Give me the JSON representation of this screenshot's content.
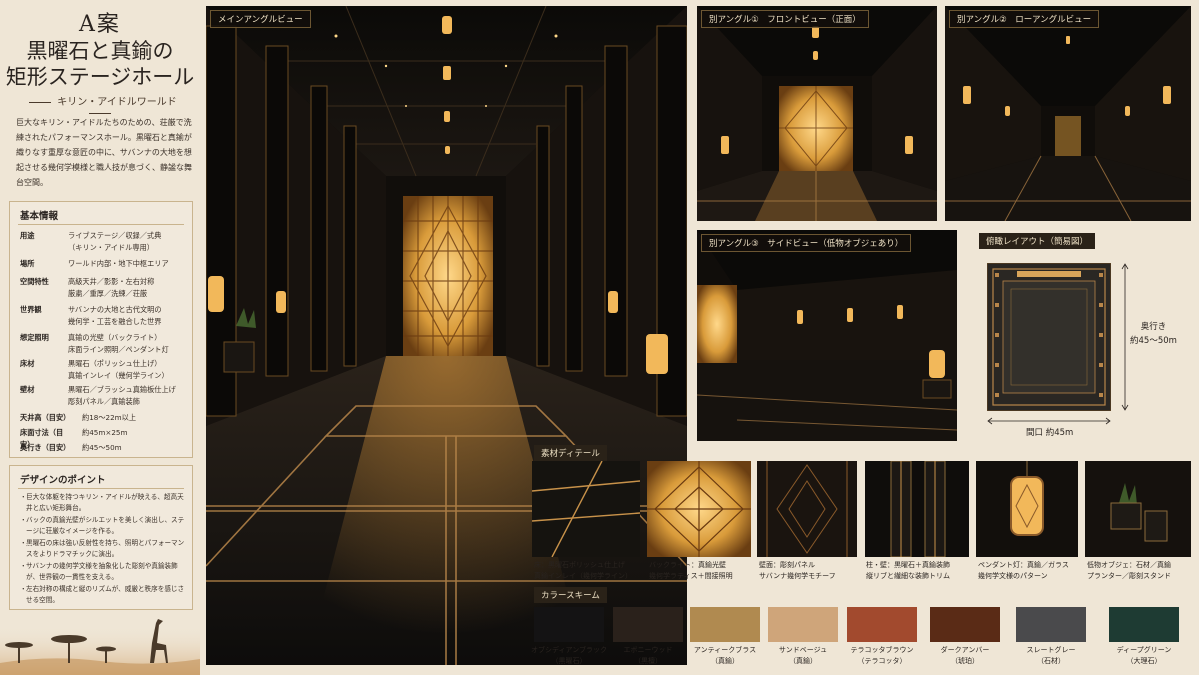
{
  "sidebar": {
    "title_line1": "A案",
    "title_line2": "黒曜石と真鍮の",
    "title_line3": "矩形ステージホール",
    "subtitle": "キリン・アイドルワールド",
    "intro": "巨大なキリン・アイドルたちのための、荘厳で洗練されたパフォーマンスホール。黒曜石と真鍮が織りなす重厚な意匠の中に、サバンナの大地を想起させる幾何学模様と職人技が息づく、静謐な舞台空間。",
    "info": {
      "title": "基本情報",
      "rows": [
        {
          "k": "用途",
          "v": "ライブステージ／収録／式典\n（キリン・アイドル専用）"
        },
        {
          "k": "場所",
          "v": "ワールド内部・地下中枢エリア"
        },
        {
          "k": "空間特性",
          "v": "高級天井／影影・左右対称\n厳粛／重厚／洗練／荘厳"
        },
        {
          "k": "世界観",
          "v": "サバンナの大地と古代文明の\n幾何学・工芸を融合した世界"
        },
        {
          "k": "想定照明",
          "v": "真鍮の光壁（バックライト）\n床面ライン照明／ペンダント灯"
        },
        {
          "k": "床材",
          "v": "黒曜石（ポリッシュ仕上げ）\n真鍮インレイ（幾何学ライン）"
        },
        {
          "k": "壁材",
          "v": "黒曜石／ブラッシュ真鍮板仕上げ\n彫刻パネル／真鍮装飾"
        }
      ],
      "dims": [
        {
          "k": "天井高（目安）",
          "v": "約18〜22m以上"
        },
        {
          "k": "床面寸法（目安）",
          "v": "約45m×25m"
        },
        {
          "k": "奥行き（目安）",
          "v": "約45〜50m"
        }
      ]
    },
    "points": {
      "title": "デザインのポイント",
      "items": [
        "巨大な体躯を持つキリン・アイドルが映える、超高天井と広い矩形舞台。",
        "バックの真鍮光壁がシルエットを美しく演出し、ステージに荘厳なイメージを作る。",
        "黒曜石の床は強い反射性を持ち、照明とパフォーマンスをよりドラマチックに演出。",
        "サバンナの幾何学文様を抽象化した彫刻や真鍮装飾が、世界観の一貫性を支える。",
        "左右対称の構成と縦のリズムが、威厳と秩序を感じさせる空間。"
      ]
    }
  },
  "views": {
    "main": "メインアングルビュー",
    "front": "別アングル①　フロントビュー（正面）",
    "low": "別アングル②　ローアングルビュー",
    "side": "別アングル③　サイドビュー（低物オブジェあり）"
  },
  "plan": {
    "title": "俯瞰レイアウト（簡易図）",
    "depth_line1": "奥行き",
    "depth_line2": "約45〜50m",
    "width": "間口 約45m"
  },
  "materials": {
    "title": "素材ディテール",
    "items": [
      {
        "caption": "床：黒曜石ポリッシュ仕上げ\n真鍮インレイ（幾何学ライン）"
      },
      {
        "caption": "バックライト：真鍮光壁\n幾何学ラティス＋間接照明"
      },
      {
        "caption": "壁面：彫刻パネル\nサバンナ幾何学モチーフ"
      },
      {
        "caption": "柱・壁：黒曜石＋真鍮装飾\n縦リブと繊細な装飾トリム"
      },
      {
        "caption": "ペンダント灯：真鍮／ガラス\n幾何学文様のパターン"
      },
      {
        "caption": "低物オブジェ：石材／真鍮\nプランター／彫刻スタンド"
      }
    ]
  },
  "colors": {
    "title": "カラースキーム",
    "items": [
      {
        "name": "オブシディアンブラック\n（黒曜石）",
        "hex": "#141314"
      },
      {
        "name": "エボニーウッド\n（黒檀）",
        "hex": "#2a211b"
      },
      {
        "name": "アンティークブラス\n（真鍮）",
        "hex": "#b08a50"
      },
      {
        "name": "サンドベージュ\n（真鍮）",
        "hex": "#cfa57a"
      },
      {
        "name": "テラコッタブラウン\n（テラコッタ）",
        "hex": "#a24a2e"
      },
      {
        "name": "ダークアンバー\n（琥珀）",
        "hex": "#5a2b16"
      },
      {
        "name": "スレートグレー\n（石材）",
        "hex": "#4a4a4c"
      },
      {
        "name": "ディープグリーン\n（大理石）",
        "hex": "#1e3b33"
      }
    ]
  }
}
